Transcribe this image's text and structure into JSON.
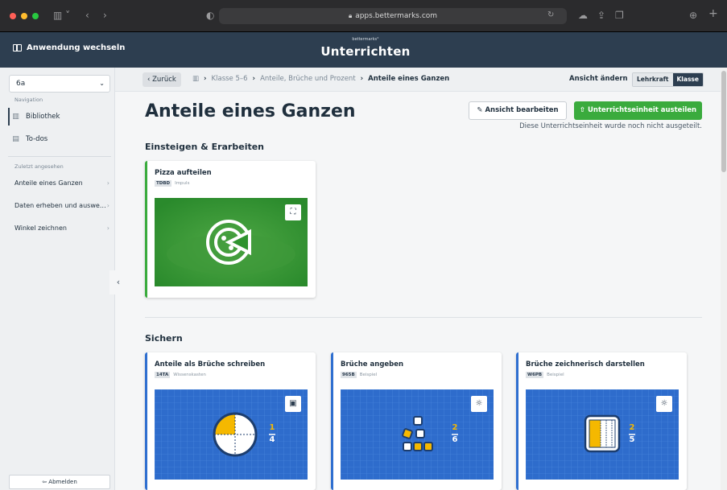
{
  "browser": {
    "url": "apps.bettermarks.com"
  },
  "header": {
    "switch_label": "Anwendung wechseln",
    "brand_small": "bettermarks°",
    "brand_title": "Unterrichten"
  },
  "sidebar": {
    "class_value": "6a",
    "navigation_label": "Navigation",
    "nav_items": [
      {
        "label": "Bibliothek",
        "icon": "library-icon"
      },
      {
        "label": "To-dos",
        "icon": "todo-icon"
      }
    ],
    "recent_label": "Zuletzt angesehen",
    "recent_items": [
      {
        "label": "Anteile eines Ganzen"
      },
      {
        "label": "Daten erheben und auswe…"
      },
      {
        "label": "Winkel zeichnen"
      }
    ],
    "logout_label": "Abmelden"
  },
  "breadcrumb": {
    "back_label": "Zurück",
    "items": [
      "Klasse 5–6",
      "Anteile, Brüche und Prozent"
    ],
    "current": "Anteile eines Ganzen",
    "view_label": "Ansicht ändern",
    "toggle_teacher": "Lehrkraft",
    "toggle_class": "Klasse"
  },
  "main": {
    "title": "Anteile eines Ganzen",
    "edit_button": "Ansicht bearbeiten",
    "share_button": "Unterrichtseinheit austeilen",
    "share_note": "Diese Unterrichtseinheit wurde noch nicht ausgeteilt.",
    "sections": [
      {
        "title": "Einsteigen & Erarbeiten",
        "cards": [
          {
            "title": "Pizza aufteilen",
            "code": "TDBD",
            "kind": "Impuls",
            "accent": "#3aab3d"
          }
        ]
      },
      {
        "title": "Sichern",
        "cards": [
          {
            "title": "Anteile als Brüche schreiben",
            "code": "14TA",
            "kind": "Wissenskasten",
            "accent": "#2f6fd0",
            "fraction_num": "1",
            "fraction_den": "4"
          },
          {
            "title": "Brüche angeben",
            "code": "965B",
            "kind": "Beispiel",
            "accent": "#2f6fd0",
            "fraction_num": "2",
            "fraction_den": "6"
          },
          {
            "title": "Brüche zeichnerisch darstellen",
            "code": "W6PB",
            "kind": "Beispiel",
            "accent": "#2f6fd0",
            "fraction_num": "2",
            "fraction_den": "5"
          }
        ]
      }
    ]
  },
  "colors": {
    "header_bg": "#2d3e50",
    "accent_green": "#3aab3d",
    "accent_blue": "#2f6fd0",
    "fraction_yellow": "#f5b800"
  }
}
